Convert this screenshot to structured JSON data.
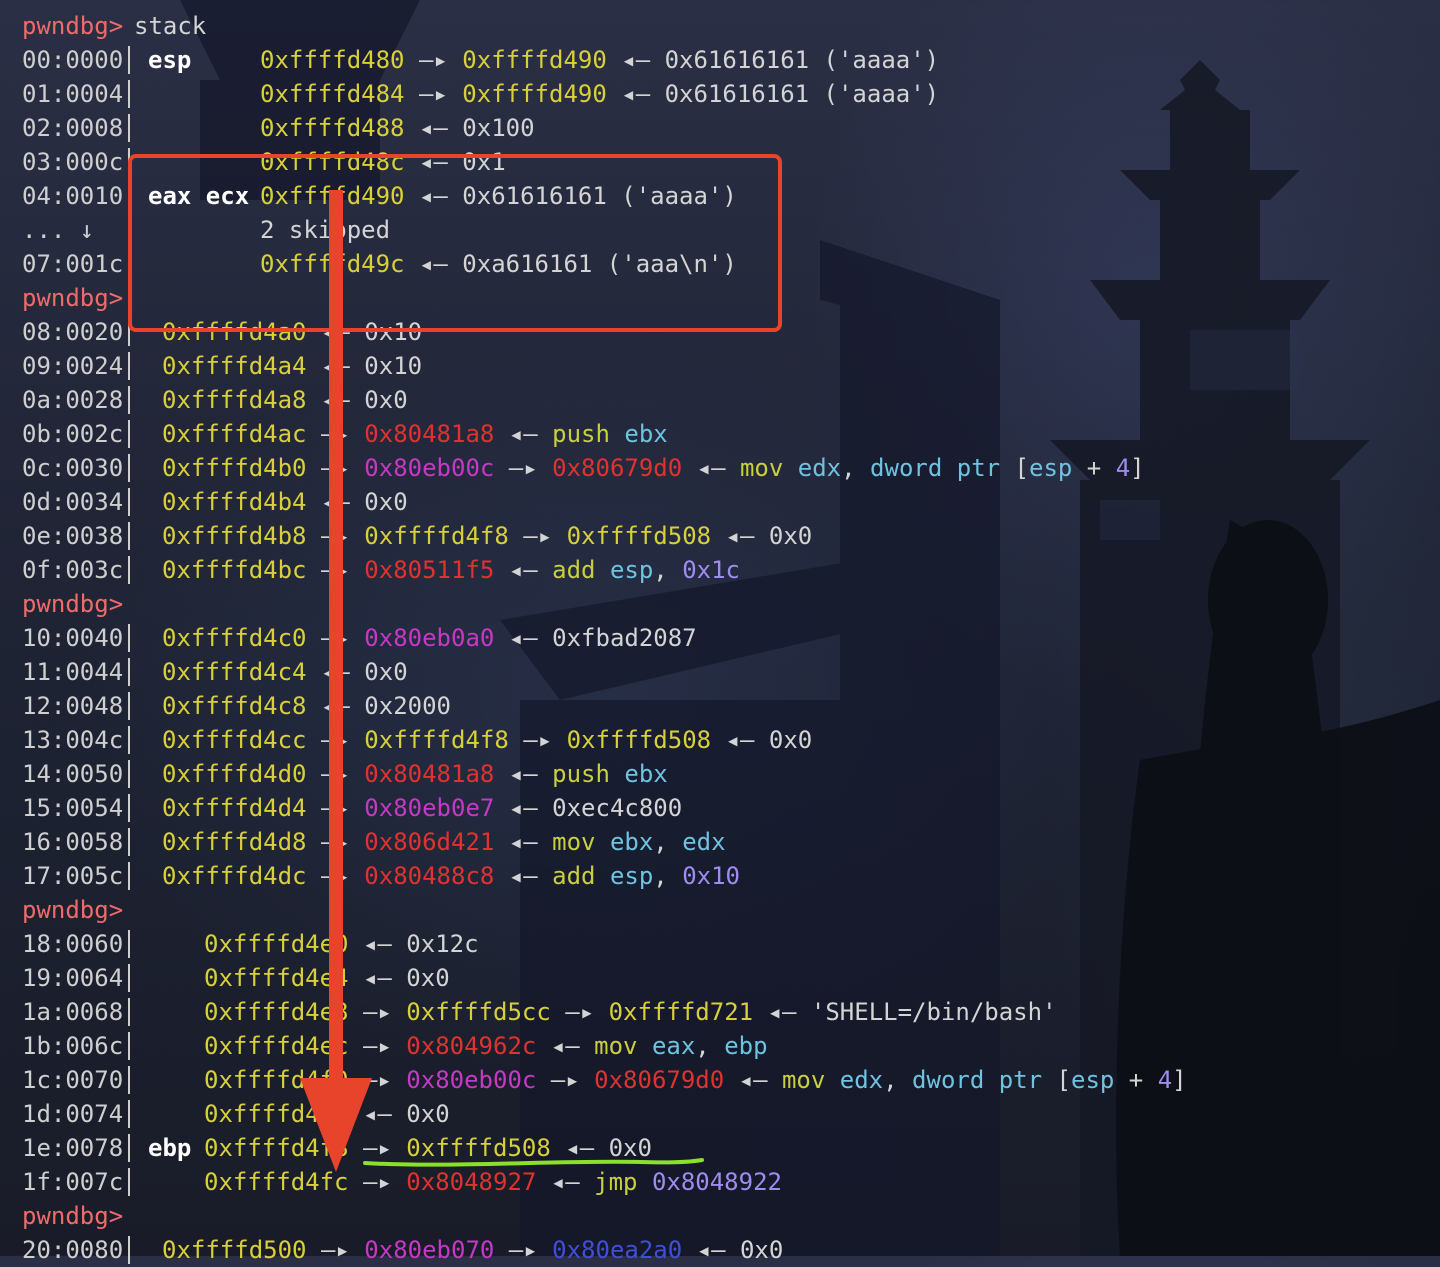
{
  "prompt": "pwndbg>",
  "command": "stack",
  "accent_colors": {
    "prompt": "#ef6b6b",
    "stack_addr": "#d8d03a",
    "code_addr": "#e0322e",
    "data_addr": "#c638c6",
    "annotation_box": "#e8442c",
    "annotation_underline": "#8be02a"
  },
  "lines": [
    {
      "type": "cmd"
    },
    {
      "type": "row",
      "off": "00:0000",
      "reg": "esp",
      "segs": [
        [
          "y",
          "0xffffd480"
        ],
        [
          "a",
          " —▸ "
        ],
        [
          "y",
          "0xffffd490"
        ],
        [
          "a",
          " ◂— "
        ],
        [
          "w",
          "0x61616161 ('aaaa')"
        ]
      ]
    },
    {
      "type": "row",
      "off": "01:0004",
      "reg": "",
      "segs": [
        [
          "y",
          "0xffffd484"
        ],
        [
          "a",
          " —▸ "
        ],
        [
          "y",
          "0xffffd490"
        ],
        [
          "a",
          " ◂— "
        ],
        [
          "w",
          "0x61616161 ('aaaa')"
        ]
      ]
    },
    {
      "type": "row",
      "off": "02:0008",
      "reg": "",
      "segs": [
        [
          "y",
          "0xffffd488"
        ],
        [
          "a",
          " ◂— "
        ],
        [
          "w",
          "0x100"
        ]
      ]
    },
    {
      "type": "row",
      "off": "03:000c",
      "reg": "",
      "segs": [
        [
          "y",
          "0xffffd48c"
        ],
        [
          "a",
          " ◂— "
        ],
        [
          "w",
          "0x1"
        ]
      ]
    },
    {
      "type": "row",
      "off": "04:0010",
      "reg": "eax ecx",
      "segs": [
        [
          "y",
          "0xffffd490"
        ],
        [
          "a",
          " ◂— "
        ],
        [
          "w",
          "0x61616161 ('aaaa')"
        ]
      ]
    },
    {
      "type": "row",
      "off": "... ↓",
      "reg": "",
      "segs": [
        [
          "w",
          "2 skipped"
        ]
      ]
    },
    {
      "type": "row",
      "off": "07:001c",
      "reg": "",
      "segs": [
        [
          "y",
          "0xffffd49c"
        ],
        [
          "a",
          " ◂— "
        ],
        [
          "w",
          "0xa616161 ('aaa\\n')"
        ]
      ]
    },
    {
      "type": "prompt"
    },
    {
      "type": "row",
      "off": "08:0020",
      "reg": "",
      "segs": [
        [
          "y",
          "0xffffd4a0"
        ],
        [
          "a",
          " ◂— "
        ],
        [
          "w",
          "0x10"
        ]
      ]
    },
    {
      "type": "row",
      "off": "09:0024",
      "reg": "",
      "segs": [
        [
          "y",
          "0xffffd4a4"
        ],
        [
          "a",
          " ◂— "
        ],
        [
          "w",
          "0x10"
        ]
      ]
    },
    {
      "type": "row",
      "off": "0a:0028",
      "reg": "",
      "segs": [
        [
          "y",
          "0xffffd4a8"
        ],
        [
          "a",
          " ◂— "
        ],
        [
          "w",
          "0x0"
        ]
      ]
    },
    {
      "type": "row",
      "off": "0b:002c",
      "reg": "",
      "segs": [
        [
          "y",
          "0xffffd4ac"
        ],
        [
          "a",
          " —▸ "
        ],
        [
          "r",
          "0x80481a8"
        ],
        [
          "a",
          " ◂— "
        ],
        [
          "g",
          "push "
        ],
        [
          "c",
          "ebx"
        ]
      ]
    },
    {
      "type": "row",
      "off": "0c:0030",
      "reg": "",
      "segs": [
        [
          "y",
          "0xffffd4b0"
        ],
        [
          "a",
          " —▸ "
        ],
        [
          "m",
          "0x80eb00c"
        ],
        [
          "a",
          " —▸ "
        ],
        [
          "r",
          "0x80679d0"
        ],
        [
          "a",
          " ◂— "
        ],
        [
          "g",
          "mov "
        ],
        [
          "c",
          "edx"
        ],
        [
          "w",
          ", "
        ],
        [
          "c",
          "dword ptr "
        ],
        [
          "w",
          "["
        ],
        [
          "c",
          "esp"
        ],
        [
          "w",
          " + "
        ],
        [
          "p",
          "4"
        ],
        [
          "w",
          "]"
        ]
      ]
    },
    {
      "type": "row",
      "off": "0d:0034",
      "reg": "",
      "segs": [
        [
          "y",
          "0xffffd4b4"
        ],
        [
          "a",
          " ◂— "
        ],
        [
          "w",
          "0x0"
        ]
      ]
    },
    {
      "type": "row",
      "off": "0e:0038",
      "reg": "",
      "segs": [
        [
          "y",
          "0xffffd4b8"
        ],
        [
          "a",
          " —▸ "
        ],
        [
          "y",
          "0xffffd4f8"
        ],
        [
          "a",
          " —▸ "
        ],
        [
          "y",
          "0xffffd508"
        ],
        [
          "a",
          " ◂— "
        ],
        [
          "w",
          "0x0"
        ]
      ]
    },
    {
      "type": "row",
      "off": "0f:003c",
      "reg": "",
      "segs": [
        [
          "y",
          "0xffffd4bc"
        ],
        [
          "a",
          " —▸ "
        ],
        [
          "r",
          "0x80511f5"
        ],
        [
          "a",
          " ◂— "
        ],
        [
          "g",
          "add "
        ],
        [
          "c",
          "esp"
        ],
        [
          "w",
          ", "
        ],
        [
          "p",
          "0x1c"
        ]
      ]
    },
    {
      "type": "prompt"
    },
    {
      "type": "row",
      "off": "10:0040",
      "reg": "",
      "segs": [
        [
          "y",
          "0xffffd4c0"
        ],
        [
          "a",
          " —▸ "
        ],
        [
          "m",
          "0x80eb0a0"
        ],
        [
          "a",
          " ◂— "
        ],
        [
          "w",
          "0xfbad2087"
        ]
      ]
    },
    {
      "type": "row",
      "off": "11:0044",
      "reg": "",
      "segs": [
        [
          "y",
          "0xffffd4c4"
        ],
        [
          "a",
          " ◂— "
        ],
        [
          "w",
          "0x0"
        ]
      ]
    },
    {
      "type": "row",
      "off": "12:0048",
      "reg": "",
      "segs": [
        [
          "y",
          "0xffffd4c8"
        ],
        [
          "a",
          " ◂— "
        ],
        [
          "w",
          "0x2000"
        ]
      ]
    },
    {
      "type": "row",
      "off": "13:004c",
      "reg": "",
      "segs": [
        [
          "y",
          "0xffffd4cc"
        ],
        [
          "a",
          " —▸ "
        ],
        [
          "y",
          "0xffffd4f8"
        ],
        [
          "a",
          " —▸ "
        ],
        [
          "y",
          "0xffffd508"
        ],
        [
          "a",
          " ◂— "
        ],
        [
          "w",
          "0x0"
        ]
      ]
    },
    {
      "type": "row",
      "off": "14:0050",
      "reg": "",
      "segs": [
        [
          "y",
          "0xffffd4d0"
        ],
        [
          "a",
          " —▸ "
        ],
        [
          "r",
          "0x80481a8"
        ],
        [
          "a",
          " ◂— "
        ],
        [
          "g",
          "push "
        ],
        [
          "c",
          "ebx"
        ]
      ]
    },
    {
      "type": "row",
      "off": "15:0054",
      "reg": "",
      "segs": [
        [
          "y",
          "0xffffd4d4"
        ],
        [
          "a",
          " —▸ "
        ],
        [
          "m",
          "0x80eb0e7"
        ],
        [
          "a",
          " ◂— "
        ],
        [
          "w",
          "0xec4c800"
        ]
      ]
    },
    {
      "type": "row",
      "off": "16:0058",
      "reg": "",
      "segs": [
        [
          "y",
          "0xffffd4d8"
        ],
        [
          "a",
          " —▸ "
        ],
        [
          "r",
          "0x806d421"
        ],
        [
          "a",
          " ◂— "
        ],
        [
          "g",
          "mov "
        ],
        [
          "c",
          "ebx"
        ],
        [
          "w",
          ", "
        ],
        [
          "c",
          "edx"
        ]
      ]
    },
    {
      "type": "row",
      "off": "17:005c",
      "reg": "",
      "segs": [
        [
          "y",
          "0xffffd4dc"
        ],
        [
          "a",
          " —▸ "
        ],
        [
          "r",
          "0x80488c8"
        ],
        [
          "a",
          " ◂— "
        ],
        [
          "g",
          "add "
        ],
        [
          "c",
          "esp"
        ],
        [
          "w",
          ", "
        ],
        [
          "p",
          "0x10"
        ]
      ]
    },
    {
      "type": "prompt"
    },
    {
      "type": "row",
      "off": "18:0060",
      "reg": "",
      "segs": [
        [
          "y",
          "0xffffd4e0"
        ],
        [
          "a",
          " ◂— "
        ],
        [
          "w",
          "0x12c"
        ]
      ]
    },
    {
      "type": "row",
      "off": "19:0064",
      "reg": "",
      "segs": [
        [
          "y",
          "0xffffd4e4"
        ],
        [
          "a",
          " ◂— "
        ],
        [
          "w",
          "0x0"
        ]
      ]
    },
    {
      "type": "row",
      "off": "1a:0068",
      "reg": "",
      "segs": [
        [
          "y",
          "0xffffd4e8"
        ],
        [
          "a",
          " —▸ "
        ],
        [
          "y",
          "0xffffd5cc"
        ],
        [
          "a",
          " —▸ "
        ],
        [
          "y",
          "0xffffd721"
        ],
        [
          "a",
          " ◂— "
        ],
        [
          "w",
          "'SHELL=/bin/bash'"
        ]
      ]
    },
    {
      "type": "row",
      "off": "1b:006c",
      "reg": "",
      "segs": [
        [
          "y",
          "0xffffd4ec"
        ],
        [
          "a",
          " —▸ "
        ],
        [
          "r",
          "0x804962c"
        ],
        [
          "a",
          " ◂— "
        ],
        [
          "g",
          "mov "
        ],
        [
          "c",
          "eax"
        ],
        [
          "w",
          ", "
        ],
        [
          "c",
          "ebp"
        ]
      ]
    },
    {
      "type": "row",
      "off": "1c:0070",
      "reg": "",
      "segs": [
        [
          "y",
          "0xffffd4f0"
        ],
        [
          "a",
          " —▸ "
        ],
        [
          "m",
          "0x80eb00c"
        ],
        [
          "a",
          " —▸ "
        ],
        [
          "r",
          "0x80679d0"
        ],
        [
          "a",
          " ◂— "
        ],
        [
          "g",
          "mov "
        ],
        [
          "c",
          "edx"
        ],
        [
          "w",
          ", "
        ],
        [
          "c",
          "dword ptr "
        ],
        [
          "w",
          "["
        ],
        [
          "c",
          "esp"
        ],
        [
          "w",
          " + "
        ],
        [
          "p",
          "4"
        ],
        [
          "w",
          "]"
        ]
      ]
    },
    {
      "type": "row",
      "off": "1d:0074",
      "reg": "",
      "segs": [
        [
          "y",
          "0xffffd4f4"
        ],
        [
          "a",
          " ◂— "
        ],
        [
          "w",
          "0x0"
        ]
      ]
    },
    {
      "type": "row",
      "off": "1e:0078",
      "reg": "ebp",
      "segs": [
        [
          "y",
          "0xffffd4f8"
        ],
        [
          "a",
          " —▸ "
        ],
        [
          "y",
          "0xffffd508"
        ],
        [
          "a",
          " ◂— "
        ],
        [
          "w",
          "0x0"
        ]
      ]
    },
    {
      "type": "row",
      "off": "1f:007c",
      "reg": "",
      "segs": [
        [
          "y",
          "0xffffd4fc"
        ],
        [
          "a",
          " —▸ "
        ],
        [
          "r",
          "0x8048927"
        ],
        [
          "a",
          " ◂— "
        ],
        [
          "g",
          "jmp "
        ],
        [
          "p",
          "0x8048922"
        ]
      ]
    },
    {
      "type": "prompt"
    },
    {
      "type": "row",
      "off": "20:0080",
      "reg": "",
      "segs": [
        [
          "y",
          "0xffffd500"
        ],
        [
          "a",
          " —▸ "
        ],
        [
          "m",
          "0x80eb070"
        ],
        [
          "a",
          " —▸ "
        ],
        [
          "b",
          "0x80ea2a0"
        ],
        [
          "a",
          " ◂— "
        ],
        [
          "w",
          "0x0"
        ]
      ]
    }
  ]
}
